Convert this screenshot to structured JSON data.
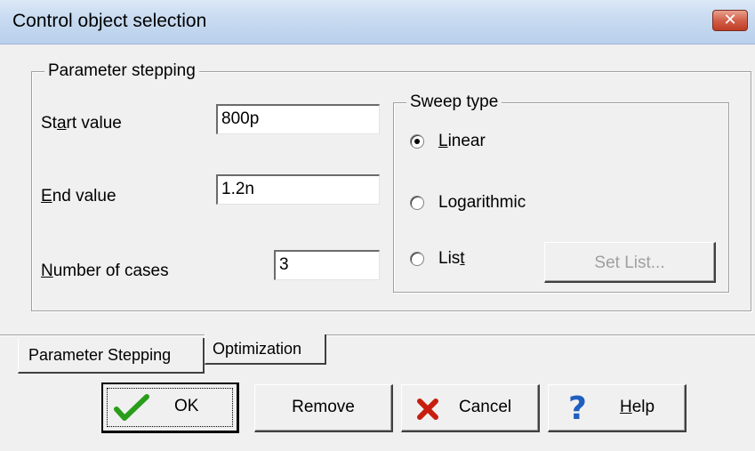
{
  "window": {
    "title": "Control object selection",
    "close_icon": "close-icon"
  },
  "parameter_group": {
    "title": "Parameter stepping",
    "start_label_pre": "St",
    "start_label_u": "a",
    "start_label_post": "rt value",
    "start_value": "800p",
    "end_label_u": "E",
    "end_label_post": "nd value",
    "end_value": "1.2n",
    "cases_label_u": "N",
    "cases_label_post": "umber of cases",
    "cases_value": "3"
  },
  "sweep_group": {
    "title": "Sweep type",
    "options": [
      {
        "pre": "",
        "u": "L",
        "post": "inear",
        "checked": true
      },
      {
        "pre": "Lo",
        "u": "g",
        "post": "arithmic",
        "checked": false
      },
      {
        "pre": "Lis",
        "u": "t",
        "post": "",
        "checked": false
      }
    ],
    "set_list_label": "Set List..."
  },
  "tabs": [
    {
      "label": "Parameter Stepping",
      "active": true
    },
    {
      "label": "Optimization",
      "active": false
    }
  ],
  "buttons": {
    "ok_label": "OK",
    "remove_label": "Remove",
    "cancel_label": "Cancel",
    "help_u": "H",
    "help_post": "elp"
  },
  "colors": {
    "ok_check": "#2a9d1a",
    "cancel_x": "#c81e0f",
    "help_q": "#1f5fbf"
  }
}
